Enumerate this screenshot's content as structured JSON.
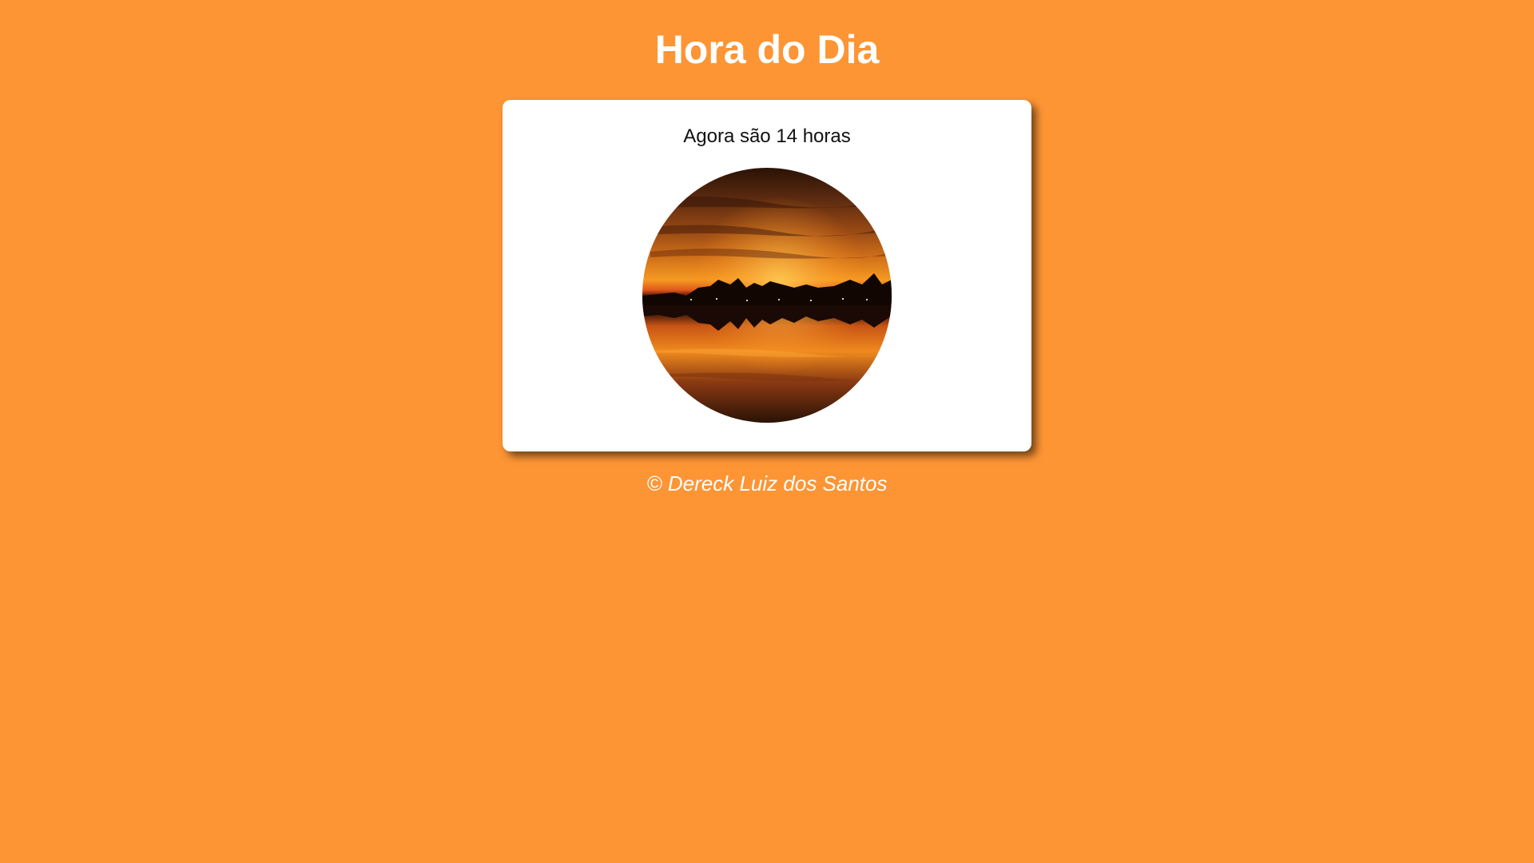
{
  "header": {
    "title": "Hora do Dia"
  },
  "card": {
    "message": "Agora são 14 horas",
    "image": {
      "subject": "sunset-beach-photo"
    }
  },
  "footer": {
    "copyright": "© Dereck Luiz dos Santos"
  },
  "colors": {
    "background": "#FD9535",
    "card_background": "#FFFFFF",
    "title_text": "#FFFFFF",
    "message_text": "#111111"
  }
}
